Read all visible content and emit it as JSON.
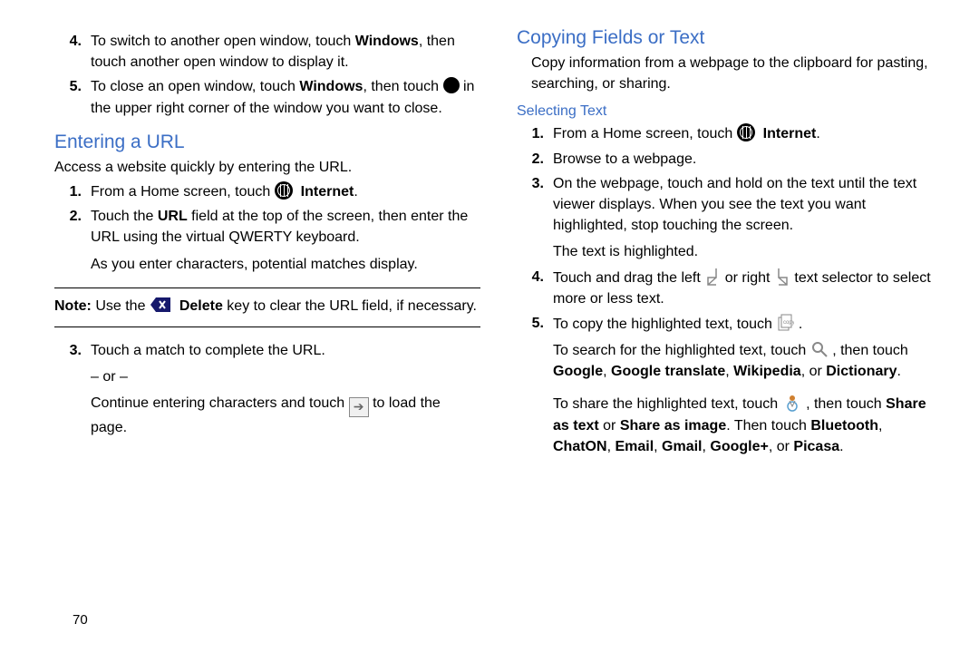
{
  "pageNumber": "70",
  "left": {
    "step4": {
      "num": "4.",
      "t1": "To switch to another open window, touch ",
      "b1": "Windows",
      "t2": ", then touch another open window to display it."
    },
    "step5": {
      "num": "5.",
      "t1": "To close an open window, touch ",
      "b1": "Windows",
      "t2": ", then touch ",
      "t3": " in the upper right corner of the window you want to close."
    },
    "heading1": "Entering a URL",
    "intro1": "Access a website quickly by entering the URL.",
    "s1": {
      "num": "1.",
      "t1": "From a Home screen, touch ",
      "b1": "Internet",
      "t2": "."
    },
    "s2": {
      "num": "2.",
      "t1": "Touch the ",
      "b1": "URL",
      "t2": " field at the top of the screen, then enter the URL using the virtual QWERTY keyboard.",
      "sub": "As you enter characters, potential matches display."
    },
    "note": {
      "label": "Note:",
      "t1": " Use the ",
      "b1": "Delete",
      "t2": " key to clear the URL field, if necessary."
    },
    "s3": {
      "num": "3.",
      "t1": "Touch a match to complete the URL.",
      "or": "– or –",
      "t2a": "Continue entering characters and touch ",
      "t2b": " to load the page."
    }
  },
  "right": {
    "heading": "Copying Fields or Text",
    "intro": "Copy information from a webpage to the clipboard for pasting, searching, or sharing.",
    "subheading": "Selecting Text",
    "s1": {
      "num": "1.",
      "t1": "From a Home screen, touch ",
      "b1": "Internet",
      "t2": "."
    },
    "s2": {
      "num": "2.",
      "t1": "Browse to a webpage."
    },
    "s3": {
      "num": "3.",
      "t1": "On the webpage, touch and hold on the text until the text viewer displays. When you see the text you want highlighted, stop touching the screen.",
      "sub": "The text is highlighted."
    },
    "s4": {
      "num": "4.",
      "t1": "Touch and drag the left ",
      "t2": " or right ",
      "t3": " text selector to select more or less text."
    },
    "s5": {
      "num": "5.",
      "t1": "To copy the highlighted text, touch ",
      "t1b": ".",
      "line2a": "To search for the highlighted text, touch ",
      "line2b": ", then touch ",
      "b1": "Google",
      "c1": ", ",
      "b2": "Google translate",
      "c2": ", ",
      "b3": "Wikipedia",
      "c3": ", or ",
      "b4": "Dictionary",
      "c4": ".",
      "line3a": "To share the highlighted text, touch ",
      "line3b": ", then touch ",
      "b5": "Share as text",
      "c5": " or ",
      "b6": "Share as image",
      "c6": ". Then touch ",
      "b7": "Bluetooth",
      "c7": ", ",
      "b8": "ChatON",
      "c8": ", ",
      "b9": "Email",
      "c9": ", ",
      "b10": "Gmail",
      "c10": ", ",
      "b11": "Google+",
      "c11": ", or ",
      "b12": "Picasa",
      "c12": "."
    }
  }
}
